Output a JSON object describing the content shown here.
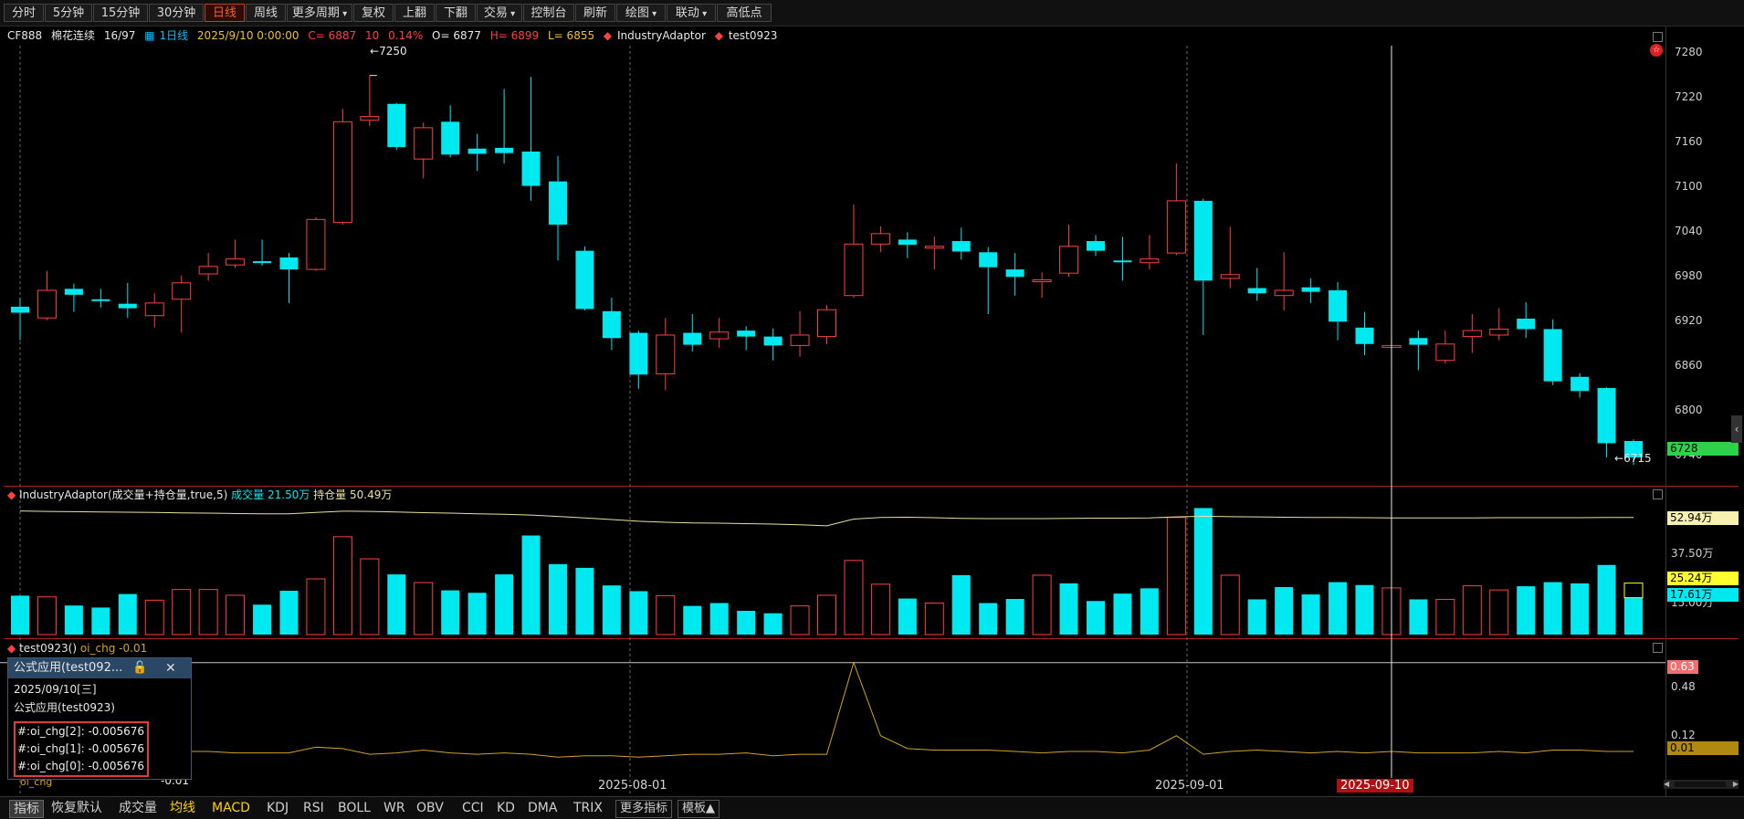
{
  "toolbar": {
    "buttons": [
      "分时",
      "5分钟",
      "15分钟",
      "30分钟",
      "日线",
      "周线",
      "更多周期",
      "复权",
      "上翻",
      "下翻",
      "交易",
      "控制台",
      "刷新",
      "绘图",
      "联动",
      "高低点"
    ],
    "active_index": 4,
    "dropdown_indices": [
      6,
      10,
      13,
      14
    ]
  },
  "info": {
    "symbol": "CF888",
    "name": "棉花连续",
    "page": "16/97",
    "period": "1日线",
    "datetime": "2025/9/10 0:00:00",
    "close": "C= 6887",
    "change": "10",
    "pct": "0.14%",
    "open": "O= 6877",
    "high": "H= 6899",
    "low": "L= 6855",
    "adaptor": "IndustryAdaptor",
    "strategy": "test0923"
  },
  "main_chart": {
    "y_ticks": [
      "7280",
      "7220",
      "7160",
      "7100",
      "7040",
      "6980",
      "6920",
      "6860",
      "6800",
      "6740"
    ],
    "high_label": "7250",
    "low_label": "6715",
    "last_price_tag": "6728"
  },
  "vol_panel": {
    "title": "IndustryAdaptor(成交量+持仓量,true,5)",
    "vol_label": "成交量",
    "vol_value": "21.50万",
    "oi_label": "持仓量",
    "oi_value": "50.49万",
    "y_ticks": [
      "37.50万",
      "15.00万"
    ],
    "tags": [
      "52.94万",
      "25.24万",
      "17.61万"
    ]
  },
  "ind_panel": {
    "title": "test0923()",
    "series": "oi_chg",
    "value": "-0.01",
    "y_ticks": [
      "0.48",
      "0.12"
    ],
    "tags": [
      "0.63",
      "0.01"
    ],
    "bottom_value": "-0.01",
    "legend": "oi_chg"
  },
  "popup": {
    "title": "公式应用(test092...",
    "date": "2025/09/10[三]",
    "subtitle": "公式应用(test0923)",
    "values": [
      "#:oi_chg[2]: -0.005676",
      "#:oi_chg[1]: -0.005676",
      "#:oi_chg[0]: -0.005676"
    ]
  },
  "x_axis": {
    "labels": [
      "2025-08-01",
      "2025-09-01"
    ],
    "cursor_label": "2025-09-10"
  },
  "bottom_tabs": [
    "指标",
    "恢复默认",
    "成交量",
    "均线",
    "MACD",
    "KDJ",
    "RSI",
    "BOLL",
    "WR",
    "OBV",
    "CCI",
    "KD",
    "DMA",
    "TRIX",
    "更多指标",
    "模板▲"
  ],
  "colors": {
    "up": "#ff4040",
    "down": "#00e8f0",
    "oi_line": "#e8e0a0",
    "ind_line": "#d4a020",
    "bg": "#000000"
  },
  "chart_data": {
    "type": "candlestick",
    "ylim": [
      6700,
      7290
    ],
    "candles": [
      {
        "o": 6940,
        "c": 6932,
        "h": 6952,
        "l": 6895
      },
      {
        "o": 6925,
        "c": 6962,
        "h": 6988,
        "l": 6922
      },
      {
        "o": 6964,
        "c": 6956,
        "h": 6971,
        "l": 6933
      },
      {
        "o": 6950,
        "c": 6948,
        "h": 6964,
        "l": 6939
      },
      {
        "o": 6944,
        "c": 6938,
        "h": 6972,
        "l": 6925
      },
      {
        "o": 6928,
        "c": 6945,
        "h": 6958,
        "l": 6912
      },
      {
        "o": 6950,
        "c": 6972,
        "h": 6982,
        "l": 6905
      },
      {
        "o": 6984,
        "c": 6994,
        "h": 7012,
        "l": 6975
      },
      {
        "o": 6996,
        "c": 7004,
        "h": 7030,
        "l": 6992
      },
      {
        "o": 7001,
        "c": 6999,
        "h": 7030,
        "l": 6995
      },
      {
        "o": 7006,
        "c": 6990,
        "h": 7012,
        "l": 6945
      },
      {
        "o": 6990,
        "c": 7057,
        "h": 7060,
        "l": 6988
      },
      {
        "o": 7053,
        "c": 7188,
        "h": 7205,
        "l": 7050
      },
      {
        "o": 7190,
        "c": 7195,
        "h": 7250,
        "l": 7182
      },
      {
        "o": 7212,
        "c": 7154,
        "h": 7213,
        "l": 7150
      },
      {
        "o": 7138,
        "c": 7180,
        "h": 7187,
        "l": 7112
      },
      {
        "o": 7188,
        "c": 7144,
        "h": 7210,
        "l": 7140
      },
      {
        "o": 7152,
        "c": 7145,
        "h": 7172,
        "l": 7122
      },
      {
        "o": 7153,
        "c": 7146,
        "h": 7232,
        "l": 7132
      },
      {
        "o": 7148,
        "c": 7102,
        "h": 7248,
        "l": 7082
      },
      {
        "o": 7108,
        "c": 7050,
        "h": 7142,
        "l": 7002
      },
      {
        "o": 7015,
        "c": 6937,
        "h": 7021,
        "l": 6935
      },
      {
        "o": 6934,
        "c": 6898,
        "h": 6952,
        "l": 6882
      },
      {
        "o": 6905,
        "c": 6849,
        "h": 6908,
        "l": 6830
      },
      {
        "o": 6850,
        "c": 6902,
        "h": 6925,
        "l": 6828
      },
      {
        "o": 6905,
        "c": 6889,
        "h": 6930,
        "l": 6880
      },
      {
        "o": 6897,
        "c": 6906,
        "h": 6925,
        "l": 6885
      },
      {
        "o": 6908,
        "c": 6900,
        "h": 6914,
        "l": 6882
      },
      {
        "o": 6900,
        "c": 6888,
        "h": 6911,
        "l": 6868
      },
      {
        "o": 6888,
        "c": 6902,
        "h": 6934,
        "l": 6873
      },
      {
        "o": 6900,
        "c": 6936,
        "h": 6942,
        "l": 6890
      },
      {
        "o": 6955,
        "c": 7024,
        "h": 7077,
        "l": 6952
      },
      {
        "o": 7024,
        "c": 7038,
        "h": 7048,
        "l": 7013
      },
      {
        "o": 7030,
        "c": 7023,
        "h": 7040,
        "l": 7005
      },
      {
        "o": 7019,
        "c": 7021,
        "h": 7034,
        "l": 6990
      },
      {
        "o": 7028,
        "c": 7014,
        "h": 7046,
        "l": 7003
      },
      {
        "o": 7013,
        "c": 6993,
        "h": 7020,
        "l": 6930
      },
      {
        "o": 6990,
        "c": 6980,
        "h": 7012,
        "l": 6955
      },
      {
        "o": 6975,
        "c": 6976,
        "h": 6986,
        "l": 6952
      },
      {
        "o": 6985,
        "c": 7021,
        "h": 7050,
        "l": 6980
      },
      {
        "o": 7028,
        "c": 7015,
        "h": 7036,
        "l": 7008
      },
      {
        "o": 7002,
        "c": 7001,
        "h": 7034,
        "l": 6975
      },
      {
        "o": 6999,
        "c": 7004,
        "h": 7036,
        "l": 6990
      },
      {
        "o": 7012,
        "c": 7082,
        "h": 7132,
        "l": 7009
      },
      {
        "o": 7082,
        "c": 6975,
        "h": 7085,
        "l": 6902
      },
      {
        "o": 6978,
        "c": 6983,
        "h": 7047,
        "l": 6965
      },
      {
        "o": 6965,
        "c": 6958,
        "h": 6992,
        "l": 6948
      },
      {
        "o": 6955,
        "c": 6962,
        "h": 7013,
        "l": 6935
      },
      {
        "o": 6966,
        "c": 6960,
        "h": 6978,
        "l": 6945
      },
      {
        "o": 6962,
        "c": 6920,
        "h": 6973,
        "l": 6895
      },
      {
        "o": 6912,
        "c": 6890,
        "h": 6933,
        "l": 6875
      },
      {
        "o": 6887,
        "c": 6888,
        "h": 6899,
        "l": 6855
      },
      {
        "o": 6898,
        "c": 6889,
        "h": 6908,
        "l": 6855
      },
      {
        "o": 6868,
        "c": 6890,
        "h": 6908,
        "l": 6864
      },
      {
        "o": 6900,
        "c": 6908,
        "h": 6930,
        "l": 6878
      },
      {
        "o": 6902,
        "c": 6910,
        "h": 6938,
        "l": 6895
      },
      {
        "o": 6924,
        "c": 6910,
        "h": 6946,
        "l": 6898
      },
      {
        "o": 6910,
        "c": 6840,
        "h": 6923,
        "l": 6835
      },
      {
        "o": 6846,
        "c": 6827,
        "h": 6851,
        "l": 6818
      },
      {
        "o": 6831,
        "c": 6757,
        "h": 6832,
        "l": 6738
      },
      {
        "o": 6760,
        "c": 6738,
        "h": 6762,
        "l": 6728
      }
    ],
    "volume": [
      9.5,
      9.2,
      7.1,
      6.6,
      9.9,
      8.4,
      11.0,
      11.0,
      9.6,
      7.3,
      10.7,
      13.6,
      23.9,
      18.5,
      14.7,
      12.7,
      10.8,
      10.2,
      14.7,
      24.2,
      17.2,
      16.3,
      12.0,
      10.6,
      9.5,
      7.0,
      7.7,
      5.8,
      5.2,
      7.0,
      9.6,
      18.1,
      12.3,
      8.8,
      7.7,
      14.5,
      7.7,
      8.7,
      14.5,
      12.5,
      8.2,
      10.0,
      11.3,
      28.6,
      30.9,
      14.5,
      8.6,
      11.6,
      9.8,
      12.8,
      12.1,
      11.4,
      8.6,
      8.6,
      11.9,
      10.9,
      11.8,
      12.8,
      12.5,
      17.0,
      9.0
    ],
    "volume_up": [
      false,
      true,
      false,
      false,
      false,
      true,
      true,
      true,
      true,
      false,
      false,
      true,
      true,
      true,
      false,
      true,
      false,
      false,
      false,
      false,
      false,
      false,
      false,
      false,
      true,
      false,
      false,
      false,
      false,
      true,
      true,
      true,
      true,
      false,
      true,
      false,
      false,
      false,
      true,
      false,
      false,
      false,
      false,
      true,
      false,
      true,
      false,
      false,
      false,
      false,
      false,
      true,
      false,
      true,
      true,
      true,
      false,
      false,
      false,
      false,
      false
    ],
    "volume_ylim": [
      0,
      31
    ],
    "open_interest": [
      56.5,
      56.3,
      56.2,
      56.0,
      55.9,
      55.8,
      55.6,
      55.5,
      55.3,
      55.2,
      55.2,
      55.8,
      56.4,
      56.3,
      56.0,
      55.7,
      55.5,
      55.2,
      55.0,
      54.6,
      54.0,
      53.3,
      52.6,
      51.8,
      51.3,
      51.0,
      50.9,
      50.7,
      50.5,
      50.2,
      49.7,
      52.8,
      53.5,
      53.6,
      53.4,
      53.1,
      53.0,
      53.0,
      53.0,
      53.1,
      53.2,
      53.2,
      53.3,
      53.8,
      54.1,
      53.9,
      53.8,
      53.6,
      53.5,
      53.5,
      53.4,
      53.3,
      53.3,
      53.3,
      53.3,
      53.4,
      53.4,
      53.4,
      53.4,
      53.5,
      53.5
    ],
    "oi_ylim": [
      0,
      58
    ],
    "oi_chg": [
      0.01,
      0.01,
      0.0,
      0.0,
      0.0,
      0.0,
      0.01,
      0.01,
      0.0,
      0.0,
      0.0,
      0.04,
      0.03,
      -0.01,
      0.0,
      0.02,
      0.0,
      -0.01,
      0.0,
      -0.01,
      -0.03,
      -0.02,
      -0.02,
      -0.03,
      -0.02,
      -0.01,
      -0.01,
      0.0,
      -0.02,
      -0.01,
      -0.01,
      0.63,
      0.12,
      0.03,
      0.02,
      0.02,
      0.02,
      0.01,
      0.0,
      0.01,
      0.01,
      0.0,
      0.02,
      0.12,
      -0.01,
      0.01,
      0.02,
      0.01,
      0.0,
      0.01,
      0.0,
      0.01,
      0.0,
      0.0,
      0.0,
      0.01,
      0.0,
      0.02,
      0.02,
      0.01,
      0.01
    ],
    "oi_chg_ylim": [
      -0.13,
      0.73
    ]
  }
}
